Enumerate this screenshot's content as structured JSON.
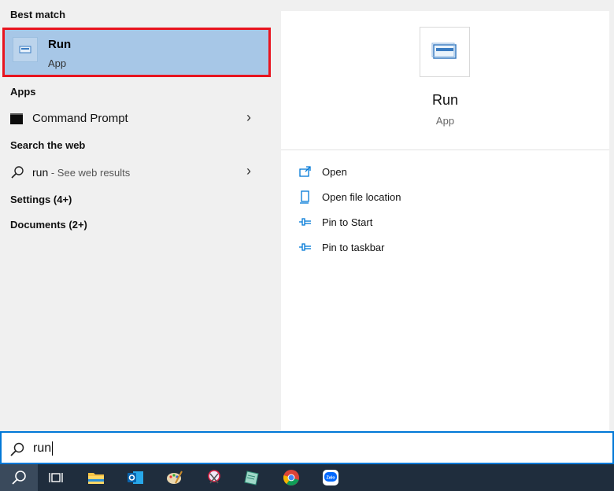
{
  "left": {
    "best_match_heading": "Best match",
    "best_item": {
      "title": "Run",
      "subtitle": "App"
    },
    "apps_heading": "Apps",
    "apps": [
      {
        "label": "Command Prompt"
      }
    ],
    "web_heading": "Search the web",
    "web_item": {
      "query": "run",
      "hint": " - See web results"
    },
    "settings_heading": "Settings (4+)",
    "documents_heading": "Documents (2+)"
  },
  "right": {
    "app_name": "Run",
    "app_type": "App",
    "actions": [
      {
        "label": "Open",
        "icon": "open-icon"
      },
      {
        "label": "Open file location",
        "icon": "file-location-icon"
      },
      {
        "label": "Pin to Start",
        "icon": "pin-icon"
      },
      {
        "label": "Pin to taskbar",
        "icon": "pin-icon"
      }
    ]
  },
  "search": {
    "value": "run"
  },
  "taskbar": {
    "items": [
      "search-icon",
      "task-view-icon",
      "file-explorer-icon",
      "outlook-icon",
      "paint-icon",
      "snipping-tool-icon",
      "notes-icon",
      "chrome-icon",
      "zalo-icon"
    ],
    "zalo_label": "Zalo"
  },
  "colors": {
    "highlight": "#a7c7e7",
    "border": "#e8141f",
    "accent": "#0078d7",
    "taskbar": "#1f2d3d"
  }
}
